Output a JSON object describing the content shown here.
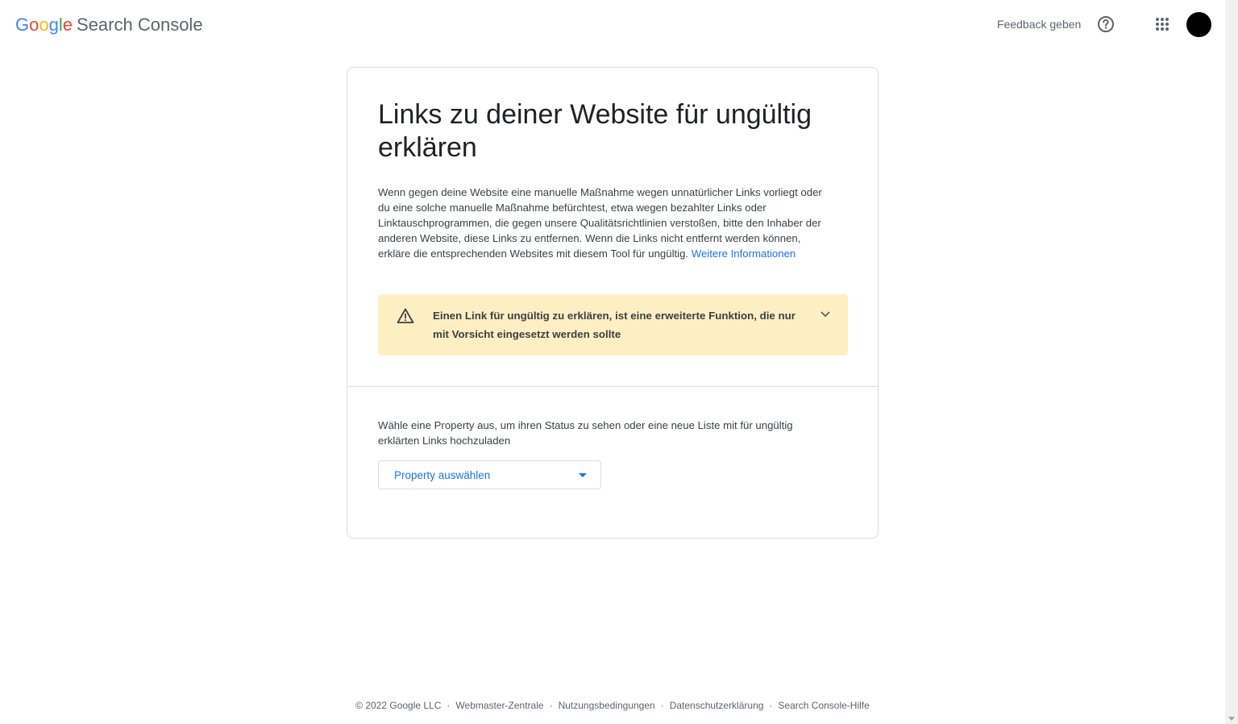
{
  "header": {
    "logo": {
      "letters": [
        "G",
        "o",
        "o",
        "g",
        "l",
        "e"
      ],
      "product": "Search Console"
    },
    "feedback_label": "Feedback geben",
    "icons": {
      "help": "help-circle-icon",
      "apps": "apps-grid-icon"
    }
  },
  "card": {
    "title": "Links zu deiner Website für ungültig erklären",
    "description": "Wenn gegen deine Website eine manuelle Maßnahme wegen unnatürlicher Links vorliegt oder du eine solche manuelle Maßnahme befürchtest, etwa wegen bezahlter Links oder Linktauschprogrammen, die gegen unsere Qualitätsrichtlinien verstoßen, bitte den Inhaber der anderen Website, diese Links zu entfernen. Wenn die Links nicht entfernt werden können, erkläre die entsprechenden Websites mit diesem Tool für ungültig.",
    "learn_more_label": "Weitere Informationen",
    "warning": {
      "icon": "warning-triangle-icon",
      "text": "Einen Link für ungültig zu erklären, ist eine erweiterte Funktion, die nur mit Vorsicht eingesetzt werden sollte",
      "expand_icon": "chevron-down-icon"
    },
    "prompt": "Wähle eine Property aus, um ihren Status zu sehen oder eine neue Liste mit für ungültig erklärten Links hochzuladen",
    "property_select": {
      "value": "Property auswählen"
    }
  },
  "footer": {
    "copyright": "© 2022 Google LLC",
    "links": [
      "Webmaster-Zentrale",
      "Nutzungsbedingungen",
      "Datenschutzerklärung",
      "Search Console-Hilfe"
    ],
    "separator": "·"
  },
  "colors": {
    "google_blue": "#4285F4",
    "google_red": "#EA4335",
    "google_yellow": "#FBBC05",
    "google_green": "#34A853",
    "link": "#1a73e8",
    "warning_bg": "#feefc3",
    "border": "#dadce0"
  }
}
